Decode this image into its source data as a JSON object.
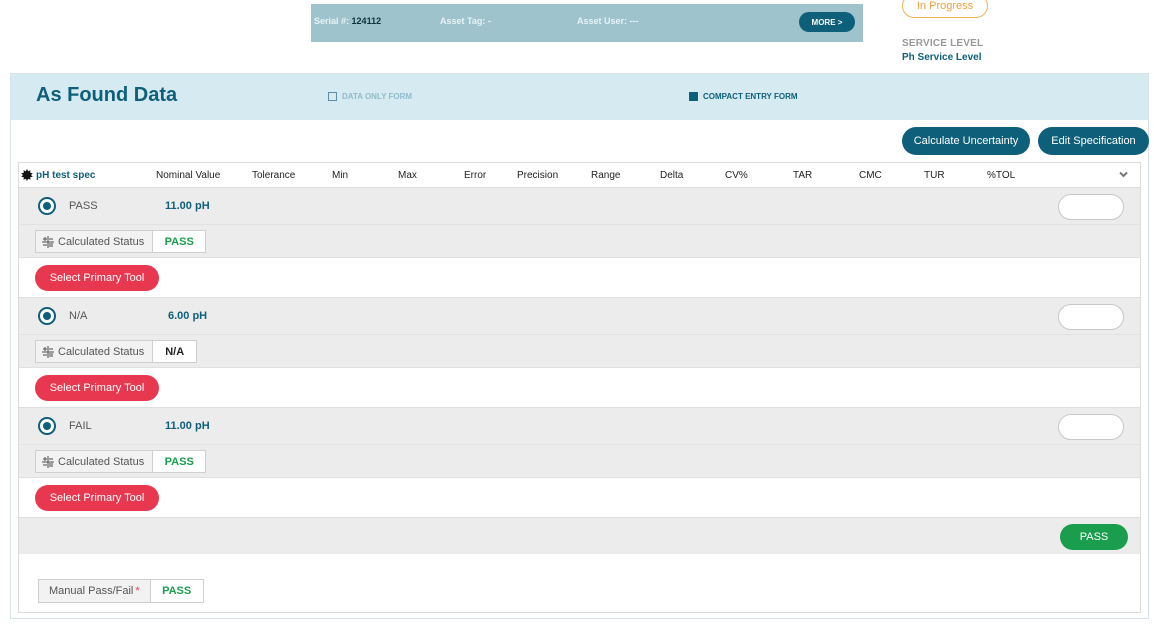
{
  "asset": {
    "serial_label": "Serial #:",
    "serial_value": "124112",
    "tag_label": "Asset Tag:",
    "tag_value": "-",
    "user_label": "Asset User:",
    "user_value": "---",
    "more_label": "MORE >"
  },
  "status": "In Progress",
  "service": {
    "label": "SERVICE LEVEL",
    "value": "Ph Service Level"
  },
  "panel": {
    "title": "As Found Data",
    "data_only_label": "DATA ONLY FORM",
    "compact_label": "COMPACT ENTRY FORM",
    "calc_uncertainty_label": "Calculate Uncertainty",
    "edit_spec_label": "Edit Specification"
  },
  "table": {
    "spec_name": "pH test spec",
    "columns": [
      "Nominal Value",
      "Tolerance",
      "Min",
      "Max",
      "Error",
      "Precision",
      "Range",
      "Delta",
      "CV%",
      "TAR",
      "CMC",
      "TUR",
      "%TOL"
    ]
  },
  "points": [
    {
      "state": "PASS",
      "nominal": "11.00 pH",
      "calc_label": "Calculated Status",
      "calc_status": "PASS",
      "calc_color": "#1a9e4e",
      "tool_label": "Select Primary Tool"
    },
    {
      "state": "N/A",
      "nominal": "6.00 pH",
      "calc_label": "Calculated Status",
      "calc_status": "N/A",
      "calc_color": "#222222",
      "tool_label": "Select Primary Tool"
    },
    {
      "state": "FAIL",
      "nominal": "11.00 pH",
      "calc_label": "Calculated Status",
      "calc_status": "PASS",
      "calc_color": "#1a9e4e",
      "tool_label": "Select Primary Tool"
    }
  ],
  "summary": {
    "result_label": "PASS",
    "manual_label": "Manual Pass/Fail",
    "manual_required": "*",
    "manual_value": "PASS"
  },
  "colors": {
    "accent": "#0d5f7a",
    "danger": "#e8384f",
    "success": "#1a9e4e",
    "warning": "#f0a040"
  }
}
